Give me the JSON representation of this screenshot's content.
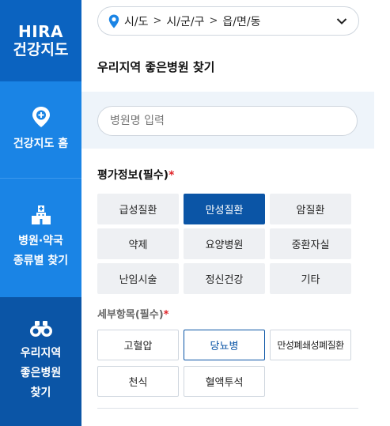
{
  "sidebar": {
    "brand": {
      "line1": "HIRA",
      "line2": "건강지도"
    },
    "items": [
      {
        "label": "건강지도 홈",
        "icon": "map-pin-plus-icon"
      },
      {
        "label_line1": "병원·약국",
        "label_line2": "종류별 찾기",
        "icon": "hospital-building-icon"
      },
      {
        "label_line1": "우리지역",
        "label_line2": "좋은병원",
        "label_line3": "찾기",
        "icon": "binoculars-icon",
        "active": true
      }
    ]
  },
  "region": {
    "level1": "시/도",
    "level2": "시/군/구",
    "level3": "읍/면/동",
    "icon": "location-pin-icon"
  },
  "page_title": "우리지역 좋은병원 찾기",
  "search": {
    "placeholder": "병원명 입력"
  },
  "evaluation": {
    "title": "평가정보(필수)",
    "required_mark": "*",
    "options": [
      "급성질환",
      "만성질환",
      "암질환",
      "약제",
      "요양병원",
      "중환자실",
      "난임시술",
      "정신건강",
      "기타"
    ],
    "selected": "만성질환"
  },
  "detail": {
    "title": "세부항목(필수)",
    "required_mark": "*",
    "options": [
      "고혈압",
      "당뇨병",
      "만성폐쇄성폐질환",
      "천식",
      "혈액투석"
    ],
    "selected": "당뇨병"
  },
  "colors": {
    "sidebar": "#1a84e5",
    "sidebar_dark": "#0b55a6",
    "accent": "#0b55a6",
    "required": "#e0262b"
  }
}
